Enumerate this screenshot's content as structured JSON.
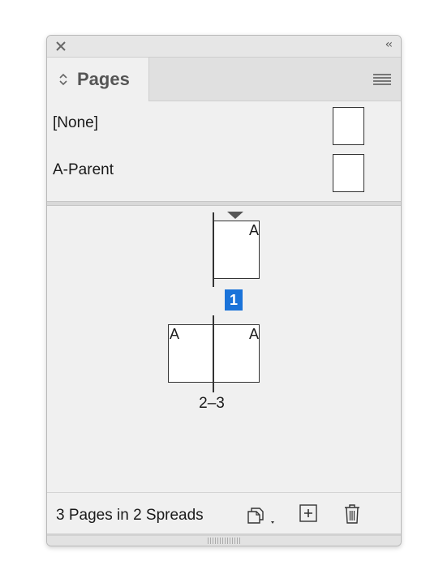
{
  "panel": {
    "tab_label": "Pages",
    "collapse_glyph": "‹‹"
  },
  "parents": [
    {
      "label": "[None]"
    },
    {
      "label": "A-Parent"
    }
  ],
  "spreads": [
    {
      "pages": [
        {
          "letter": "A"
        }
      ],
      "label": "1",
      "selected": true
    },
    {
      "pages": [
        {
          "letter": "A"
        },
        {
          "letter": "A"
        }
      ],
      "label": "2–3",
      "selected": false
    }
  ],
  "footer": {
    "status": "3 Pages in 2 Spreads"
  },
  "colors": {
    "selected": "#1a73d9",
    "panel_bg": "#f0f0f0"
  },
  "icons": [
    "close-icon",
    "collapse-icon",
    "sort-arrows-icon",
    "panel-menu-icon",
    "edit-page-size-icon",
    "new-page-icon",
    "trash-icon"
  ]
}
